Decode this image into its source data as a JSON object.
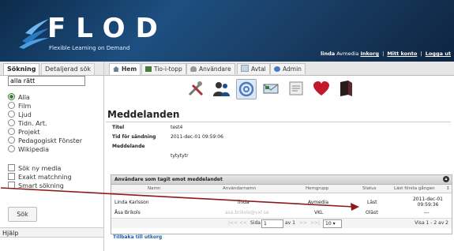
{
  "header": {
    "logo_text": "FLOD",
    "tagline": "Flexible Learning on Demand",
    "user": "linda",
    "school": "Avmedia",
    "link_settings": "Inkorg",
    "link_account": "Mitt konto",
    "link_logout": "Logga ut",
    "sep": "|",
    "brand_color": "#1d4f80"
  },
  "sidebar": {
    "tabs": [
      "Sökning",
      "Detaljerad sök"
    ],
    "search_value": "alla rätt",
    "filters": [
      {
        "label": "Alla",
        "selected": true
      },
      {
        "label": "Film",
        "selected": false
      },
      {
        "label": "Ljud",
        "selected": false
      },
      {
        "label": "Tidn. Art.",
        "selected": false
      },
      {
        "label": "Projekt",
        "selected": false
      },
      {
        "label": "Pedagogiskt Fönster",
        "selected": false
      },
      {
        "label": "Wikipedia",
        "selected": false
      }
    ],
    "options": [
      {
        "label": "Sök ny media",
        "checked": false
      },
      {
        "label": "Exakt matchning",
        "checked": false
      },
      {
        "label": "Smart sökning",
        "checked": false
      }
    ],
    "search_button": "Sök",
    "help": "Hjälp"
  },
  "nav": {
    "tabs": [
      {
        "label": "Hem",
        "icon": "home-icon",
        "active": true
      },
      {
        "label": "Tio-i-topp",
        "icon": "film-icon",
        "active": false
      },
      {
        "label": "Användare",
        "icon": "user-icon",
        "active": false
      },
      {
        "label": "Avtal",
        "icon": "document-icon",
        "active": false
      },
      {
        "label": "Admin",
        "icon": "gear-icon",
        "active": false
      }
    ]
  },
  "toolbar": {
    "icons": [
      "tools-icon",
      "users-icon",
      "mail-at-icon",
      "mail-icon",
      "tags-icon",
      "heart-icon",
      "book-icon"
    ]
  },
  "page": {
    "title": "Meddelanden"
  },
  "message": {
    "title_label": "Titel",
    "title_value": "test4",
    "time_label": "Tid för sändning",
    "time_value": "2011-dec-01 09:59:06",
    "body_label": "Meddelande",
    "body_value": "tytytytr"
  },
  "recipients": {
    "heading": "Användare som tagit emot meddelandet",
    "columns": [
      "Namn",
      "Användarnamn",
      "Hemgrupp",
      "Status",
      "Läst första gången"
    ],
    "sort_icon": "sort-icon",
    "rows": [
      {
        "name": "Linda Karlsson",
        "username": "linda",
        "group": "Avmedia",
        "status": "Läst",
        "first_read": "2011-dec-01 09:59:36"
      },
      {
        "name": "Åsa Brikols",
        "username": "asa.brikols@vxl.se",
        "group": "VKL",
        "status": "Oläst",
        "first_read": "---"
      }
    ],
    "pager": {
      "first": "|<<",
      "prev": "<<",
      "page_label": "Sida",
      "page_value": "1",
      "of_label": "av 1",
      "next": ">>",
      "last": ">>|",
      "per_page": "10",
      "summary": "Visa 1 - 2 av 2"
    }
  },
  "back_link": "Tillbaka till utkorg",
  "annotation": {
    "arrow_color": "#8b1a1a"
  }
}
